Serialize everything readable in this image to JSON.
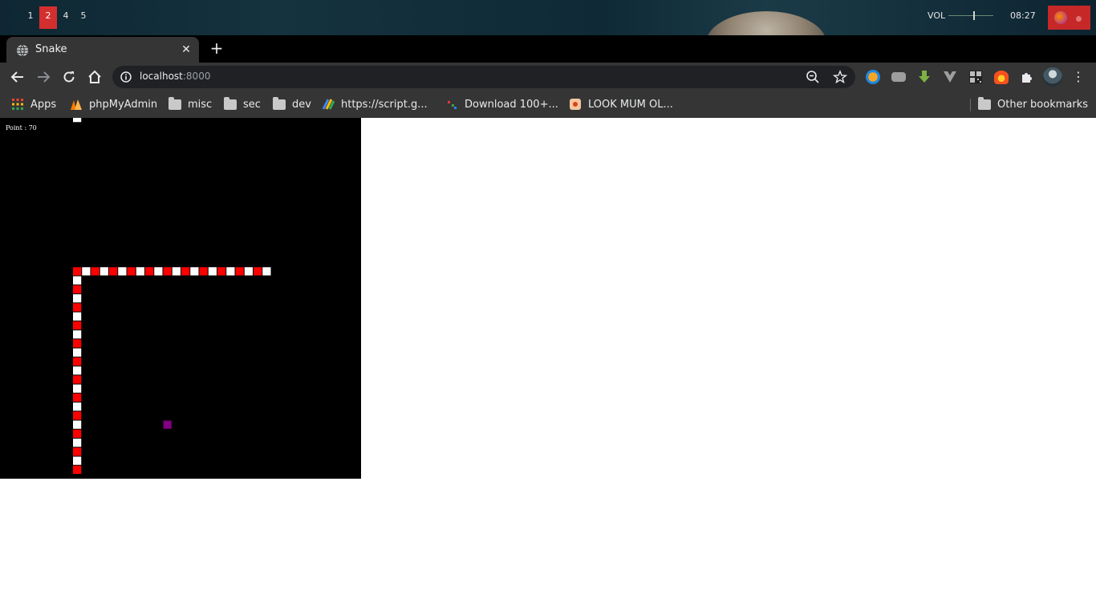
{
  "wm": {
    "workspaces": [
      {
        "label": "1",
        "active": false
      },
      {
        "label": "2",
        "active": true
      },
      {
        "label": "4",
        "active": false
      },
      {
        "label": "5",
        "active": false
      }
    ],
    "volume_label": "VOL",
    "volume_level": 0.55,
    "clock": "08:27"
  },
  "browser": {
    "tab": {
      "title": "Snake",
      "close_glyph": "✕"
    },
    "new_tab_glyph": "+",
    "omnibox": {
      "host": "localhost",
      "port": ":8000"
    },
    "menu_glyph": "⋮",
    "bookmarks": [
      {
        "label": "Apps",
        "icon": "apps-grid-icon"
      },
      {
        "label": "phpMyAdmin",
        "icon": "phpmyadmin-icon"
      },
      {
        "label": "misc",
        "icon": "folder-icon"
      },
      {
        "label": "sec",
        "icon": "folder-icon"
      },
      {
        "label": "dev",
        "icon": "folder-icon"
      },
      {
        "label": "https://script.g...",
        "icon": "script-icon"
      },
      {
        "label": "Download 100+...",
        "icon": "download-site-icon"
      },
      {
        "label": "LOOK MUM OL...",
        "icon": "bookmark-page-icon"
      }
    ],
    "other_bookmarks": "Other bookmarks"
  },
  "game": {
    "score_text": "Point : 70",
    "colors": {
      "background": "#000000",
      "white": "#ffffff",
      "red": "#ff0000",
      "food": "#800080"
    },
    "grid_cell": 11.25,
    "food": {
      "col": 18,
      "row": 34
    },
    "stray_segment": {
      "col": 8,
      "row": 0
    },
    "snake_horizontal": {
      "row": 17,
      "from_col": 8,
      "to_col": 29
    },
    "snake_vertical": {
      "col": 8,
      "from_row": 18,
      "to_row": 39
    }
  }
}
